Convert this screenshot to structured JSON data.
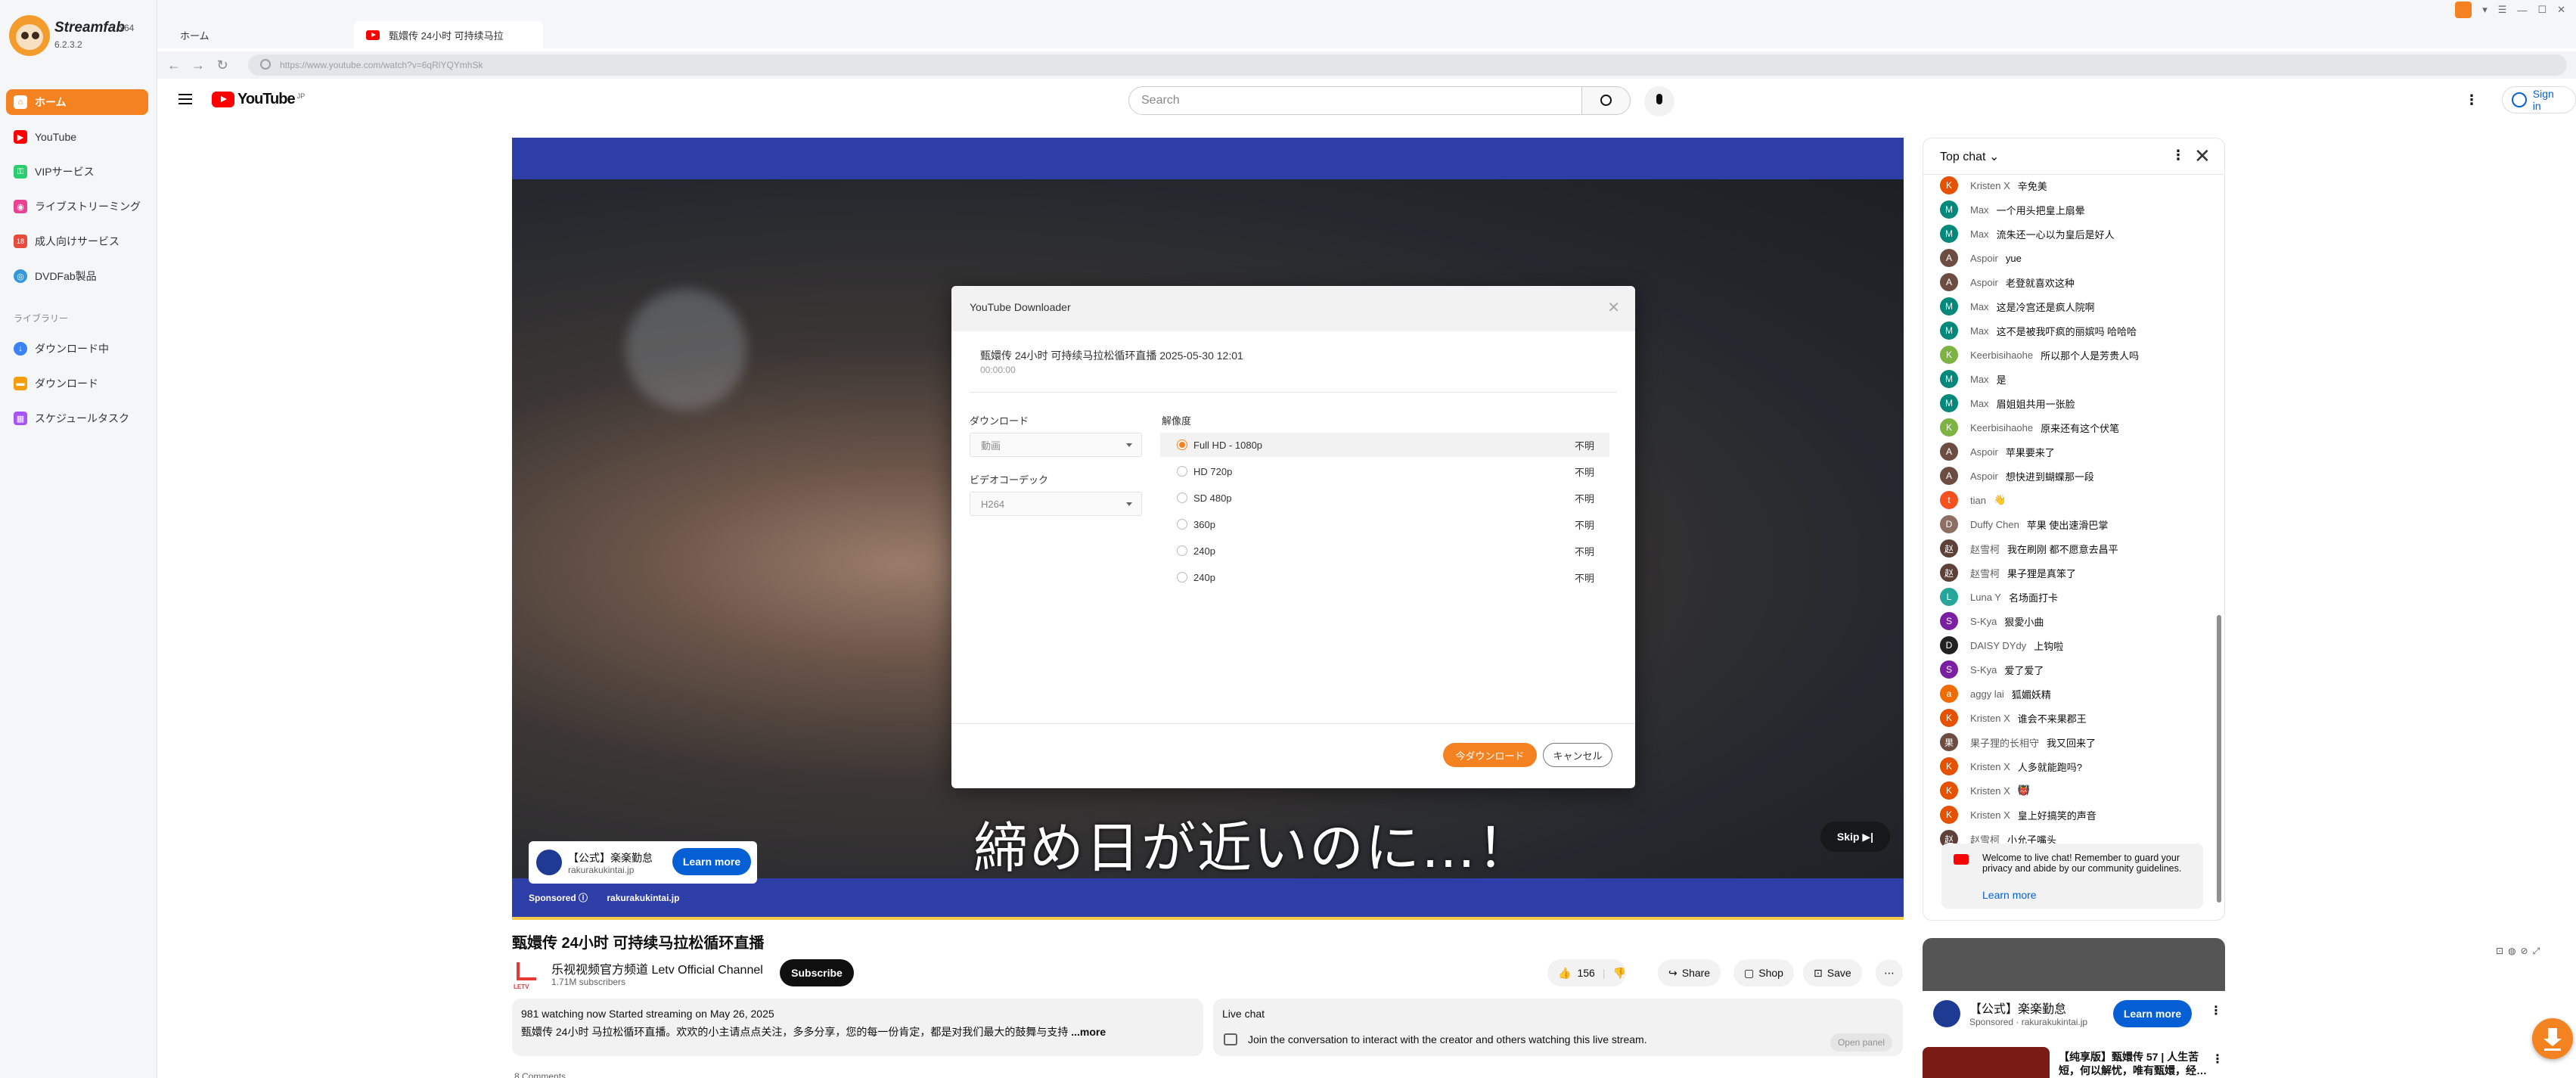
{
  "app": {
    "name": "Streamfab",
    "edition": "x64",
    "version": "6.2.3.2"
  },
  "sidebar": {
    "items": [
      {
        "label": "ホーム",
        "color": "#f58220"
      },
      {
        "label": "YouTube",
        "color": "#ff0000"
      },
      {
        "label": "VIPサービス",
        "color": "#2ecc71"
      },
      {
        "label": "ライブストリーミング",
        "color": "#e84393"
      },
      {
        "label": "成人向けサービス",
        "color": "#e74c3c"
      },
      {
        "label": "DVDFab製品",
        "color": "#3498db"
      }
    ],
    "library_label": "ライブラリー",
    "library_items": [
      {
        "label": "ダウンロード中",
        "color": "#3b82f6"
      },
      {
        "label": "ダウンロード",
        "color": "#f59e0b"
      },
      {
        "label": "スケジュールタスク",
        "color": "#a855f7"
      }
    ]
  },
  "tabs": [
    {
      "label": "ホーム"
    },
    {
      "label": "甄嬛传 24小时 可持续马拉"
    }
  ],
  "browser": {
    "url": "https://www.youtube.com/watch?v=6qRlYQYmhSk",
    "back": "←",
    "forward": "→",
    "reload": "↻"
  },
  "youtube": {
    "logo": "YouTube",
    "logo_region": "JP",
    "search_placeholder": "Search",
    "signin_label": "Sign in"
  },
  "video": {
    "subtitle": "締め日が近いのに…！",
    "skip_label": "Skip ▶|",
    "ad": {
      "title": "【公式】楽楽勤怠",
      "domain": "rakurakukintai.jp",
      "cta": "Learn more",
      "sponsored": "Sponsored",
      "sponsored_domain": "rakurakukintai.jp"
    },
    "title": "甄嬛传 24小时 可持续马拉松循环直播",
    "channel": {
      "name": "乐视视频官方频道 Letv Official Channel",
      "subscribers": "1.71M subscribers",
      "logo_text": "LETV"
    },
    "subscribe_label": "Subscribe",
    "likes": "156",
    "share_label": "Share",
    "shop_label": "Shop",
    "save_label": "Save",
    "description": {
      "meta": "981 watching now  Started streaming on May 26, 2025",
      "text": "甄嬛传 24小时 马拉松循环直播。欢欢的小主请点点关注，多多分享，您的每一份肯定，都是对我们最大的鼓舞与支持",
      "more": " ...more"
    },
    "live_chat": {
      "title": "Live chat",
      "text": "Join the conversation to interact with the creator and others watching this live stream.",
      "open_label": "Open panel"
    },
    "below": "8 Comments"
  },
  "chat": {
    "mode_label": "Top chat",
    "messages": [
      {
        "author": "Kristen X",
        "text": "辛免美",
        "color": "#e65100",
        "initial": "K"
      },
      {
        "author": "Max",
        "text": "一个用头把皇上扇晕",
        "color": "#00897b",
        "initial": "M"
      },
      {
        "author": "Max",
        "text": "流朱还一心以为皇后是好人",
        "color": "#00897b",
        "initial": "M"
      },
      {
        "author": "Aspoir",
        "text": "yue",
        "color": "#6d4c41",
        "initial": "A"
      },
      {
        "author": "Aspoir",
        "text": "老登就喜欢这种",
        "color": "#6d4c41",
        "initial": "A"
      },
      {
        "author": "Max",
        "text": "这是冷宫还是疯人院啊",
        "color": "#00897b",
        "initial": "M"
      },
      {
        "author": "Max",
        "text": "这不是被我吓疯的丽嫔吗 哈哈哈",
        "color": "#00897b",
        "initial": "M"
      },
      {
        "author": "Keerbisihaohe",
        "text": "所以那个人是芳贵人吗",
        "color": "#7cb342",
        "initial": "K"
      },
      {
        "author": "Max",
        "text": "是",
        "color": "#00897b",
        "initial": "M"
      },
      {
        "author": "Max",
        "text": "眉姐姐共用一张脸",
        "color": "#00897b",
        "initial": "M"
      },
      {
        "author": "Keerbisihaohe",
        "text": "原来还有这个伏笔",
        "color": "#7cb342",
        "initial": "K"
      },
      {
        "author": "Aspoir",
        "text": "苹果要来了",
        "color": "#6d4c41",
        "initial": "A"
      },
      {
        "author": "Aspoir",
        "text": "想快进到蝴蝶那一段",
        "color": "#6d4c41",
        "initial": "A"
      },
      {
        "author": "tian",
        "text": "👋",
        "color": "#f4511e",
        "initial": "t"
      },
      {
        "author": "Duffy Chen",
        "text": "苹果 使出速滑巴掌",
        "color": "#8d6e63",
        "initial": "D"
      },
      {
        "author": "赵雪柯",
        "text": "我在刷刚 都不愿意去昌平",
        "color": "#5d4037",
        "initial": "赵"
      },
      {
        "author": "赵雪柯",
        "text": "果子狸是真笨了",
        "color": "#5d4037",
        "initial": "赵"
      },
      {
        "author": "Luna Y",
        "text": "名场面打卡",
        "color": "#26a69a",
        "initial": "L"
      },
      {
        "author": "S-Kya",
        "text": "狠愛小曲",
        "color": "#7b1fa2",
        "initial": "S"
      },
      {
        "author": "DAISY DYdy",
        "text": "上钩啦",
        "color": "#212121",
        "initial": "D"
      },
      {
        "author": "S-Kya",
        "text": "爱了爱了",
        "color": "#7b1fa2",
        "initial": "S"
      },
      {
        "author": "aggy lai",
        "text": "狐媚妖精",
        "color": "#ef6c00",
        "initial": "a"
      },
      {
        "author": "Kristen X",
        "text": "谁会不来果郡王",
        "color": "#e65100",
        "initial": "K"
      },
      {
        "author": "果子狸的长相守",
        "text": "我又回来了",
        "color": "#6d4c41",
        "initial": "果"
      },
      {
        "author": "Kristen X",
        "text": "人多就能跑吗?",
        "color": "#e65100",
        "initial": "K"
      },
      {
        "author": "Kristen X",
        "text": "👹",
        "color": "#e65100",
        "initial": "K"
      },
      {
        "author": "Kristen X",
        "text": "皇上好搞笑的声音",
        "color": "#e65100",
        "initial": "K"
      },
      {
        "author": "赵雪柯",
        "text": "小允子嘴头",
        "color": "#5d4037",
        "initial": "赵"
      }
    ],
    "welcome": "Welcome to live chat! Remember to guard your privacy and abide by our community guidelines.",
    "learn_more": "Learn more"
  },
  "side_ad": {
    "title": "【公式】楽楽勤怠",
    "sponsored": "Sponsored · rakurakukintai.jp",
    "cta": "Learn more"
  },
  "recommended": {
    "title": "【纯享版】甄嬛传 57 | 人生苦短，何以解忧，唯有甄嬛，经…"
  },
  "dialog": {
    "title": "YouTube Downloader",
    "video_title": "甄嬛传 24小时 可持续马拉松循环直播 2025-05-30 12:01",
    "duration": "00:00:00",
    "download_label": "ダウンロード",
    "download_value": "動画",
    "codec_label": "ビデオコーデック",
    "codec_value": "H264",
    "resolution_label": "解像度",
    "resolutions": [
      {
        "label": "Full HD - 1080p",
        "size": "不明",
        "selected": true
      },
      {
        "label": "HD 720p",
        "size": "不明",
        "selected": false
      },
      {
        "label": "SD 480p",
        "size": "不明",
        "selected": false
      },
      {
        "label": "360p",
        "size": "不明",
        "selected": false
      },
      {
        "label": "240p",
        "size": "不明",
        "selected": false
      },
      {
        "label": "240p",
        "size": "不明",
        "selected": false
      }
    ],
    "primary_label": "今ダウンロード",
    "cancel_label": "キャンセル"
  }
}
